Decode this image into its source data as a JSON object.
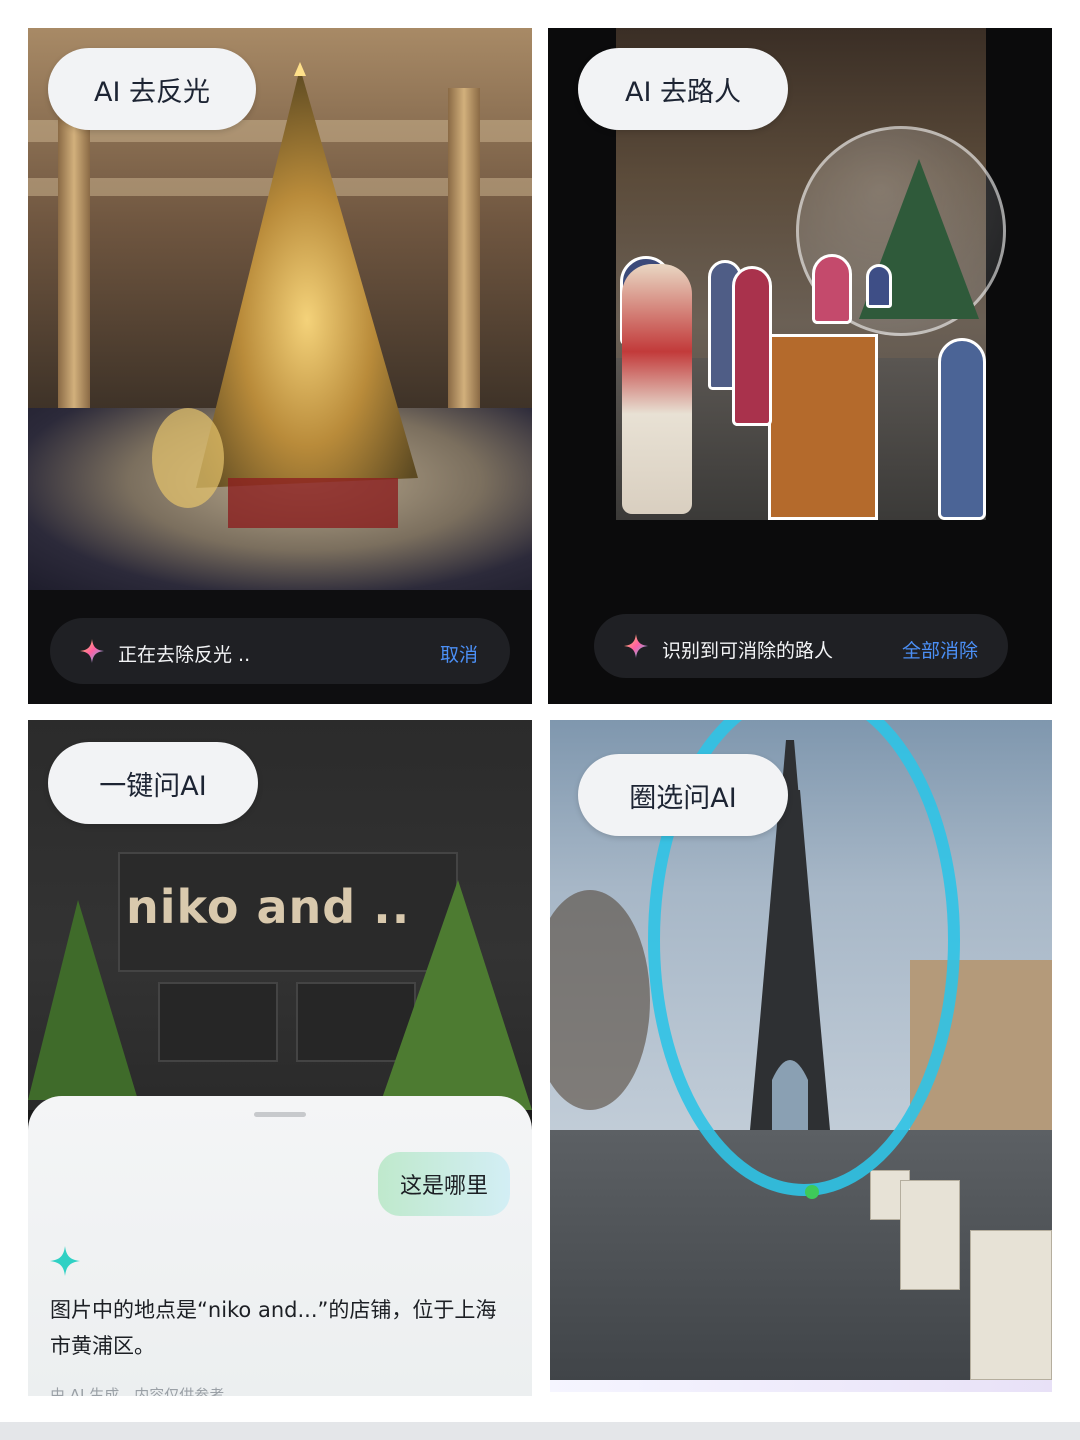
{
  "panels": {
    "glare": {
      "pill_label": "AI 去反光",
      "status_text": "正在去除反光 ..",
      "action_label": "取消"
    },
    "passersby": {
      "pill_label": "AI 去路人",
      "status_text": "识别到可消除的路人",
      "action_label": "全部消除"
    },
    "ask": {
      "pill_label": "一键问AI",
      "sign_text": "niko and ..",
      "question": "这是哪里",
      "answer": "图片中的地点是“niko and...”的店铺，位于上海市黄浦区。",
      "footnote": "由 AI 生成，内容仅供参考"
    },
    "circle": {
      "pill_label": "圈选问AI",
      "selection_color": "#2fc3e6"
    }
  },
  "colors": {
    "pill_bg": "#f2f3f5",
    "action_blue": "#4b8ff5",
    "bar_bg": "#1f2024"
  },
  "icons": [
    "ai-sparkle-icon",
    "ai-star-icon"
  ]
}
